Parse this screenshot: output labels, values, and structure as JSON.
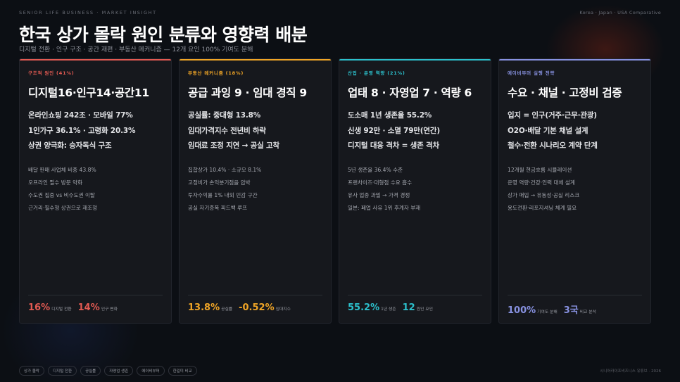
{
  "header": {
    "eyebrow": "SENIOR LIFE BUSINESS · MARKET INSIGHT",
    "right_label": "Korea · Japan · USA Comparative",
    "title": "한국 상가 몰락 원인 분류와 영향력 배분",
    "subtitle": "디지털 전환 · 인구 구조 · 공간 재편 · 부동산 메커니즘 — 12개 요인 100% 기여도 분해"
  },
  "colors": {
    "card1": "#e25a52",
    "card2": "#f0a526",
    "card3": "#2cc0cc",
    "card4": "#8791e0"
  },
  "cards": [
    {
      "tag": "구조적 원인 (41%)",
      "heading": "디지털16·인구14·공간11",
      "facts": [
        "온라인쇼핑 242조 · 모바일 77%",
        "1인가구 36.1% · 고령화 20.3%",
        "상권 양극화: 승자독식 구조"
      ],
      "notes": [
        "배달 판매 사업체 비중 43.8%",
        "오프라인 필수 방문 약화",
        "수도권 집중 vs 비수도권 이탈",
        "근거리·필수형 상권으로 재조정"
      ],
      "stats": [
        {
          "value": "16%",
          "label": "디지털 전환"
        },
        {
          "value": "14%",
          "label": "인구 변화"
        }
      ]
    },
    {
      "tag": "부동산 메커니즘 (18%)",
      "heading": "공급 과잉 9 · 임대 경직 9",
      "facts": [
        "공실률: 중대형 13.8%",
        "임대가격지수 전년비 하락",
        "임대료 조정 지연 → 공실 고착"
      ],
      "notes": [
        "집합상가 10.4% · 소규모 8.1%",
        "고정비가 손익분기점을 압박",
        "투자수익률 1% 내외 민감 구간",
        "공실 자기증폭 피드백 루프"
      ],
      "stats": [
        {
          "value": "13.8%",
          "label": "공실률"
        },
        {
          "value": "-0.52%",
          "label": "임대지수"
        }
      ]
    },
    {
      "tag": "산업 · 운영 역량 (21%)",
      "heading": "업태 8 · 자영업 7 · 역량 6",
      "facts": [
        "도소매 1년 생존율 55.2%",
        "신생 92만 · 소멸 79만(연간)",
        "디지털 대응 격차 = 생존 격차"
      ],
      "notes": [
        "5년 생존율 36.4% 수준",
        "프랜차이즈·대형점 수요 흡수",
        "유사 업종 과밀 → 가격 경쟁",
        "일본: 폐업 사유 1위 후계자 부재"
      ],
      "stats": [
        {
          "value": "55.2%",
          "label": "1년 생존"
        },
        {
          "value": "12",
          "label": "원인 요인"
        }
      ]
    },
    {
      "tag": "에이비부머 실행 전략",
      "heading": "수요 · 채널 · 고정비 검증",
      "facts": [
        "입지 = 인구(거주·근무·관광)",
        "O2O·배달 기본 채널 설계",
        "철수·전환 시나리오 계약 단계"
      ],
      "notes": [
        "12개월 현금흐름 시뮬레이션",
        "운영 역량·건강·인력 대체 설계",
        "상가 매입 → 유동성·공실 리스크",
        "용도전환·리포지셔닝 체계 필요"
      ],
      "stats": [
        {
          "value": "100%",
          "label": "기여도 분해"
        },
        {
          "value": "3국",
          "label": "비교 분석"
        }
      ]
    }
  ],
  "footer": {
    "chips": [
      "상가 몰락",
      "디지털 전환",
      "공실률",
      "자영업 생존",
      "에이비부머",
      "한일미 비교"
    ],
    "right_label": "시니어라이프비즈니스 유튜브 · 2026"
  }
}
